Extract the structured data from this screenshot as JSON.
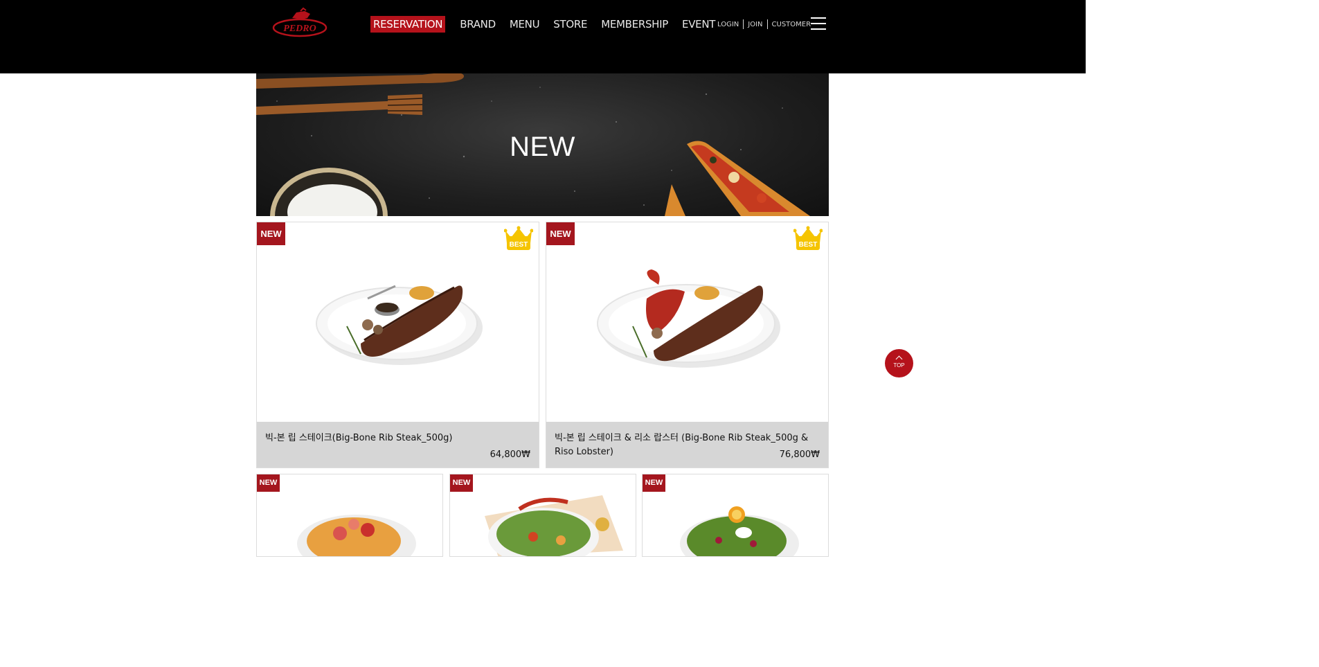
{
  "header": {
    "logo_text": "PEDRO",
    "nav": [
      "RESERVATION",
      "BRAND",
      "MENU",
      "STORE",
      "MEMBERSHIP",
      "EVENT"
    ],
    "util": [
      "LOGIN",
      "JOIN",
      "CUSTOMER"
    ],
    "menu_icon": "hamburger-icon"
  },
  "hero": {
    "title": "NEW"
  },
  "products_featured": [
    {
      "badge": "NEW",
      "best_label": "BEST",
      "name": "빅-본 립 스테이크(Big-Bone Rib Steak_500g)",
      "price": "64,800₩"
    },
    {
      "badge": "NEW",
      "best_label": "BEST",
      "name": "빅-본 립 스테이크 & 리소 랍스터 (Big-Bone Rib Steak_500g & Riso Lobster)",
      "price": "76,800₩"
    }
  ],
  "products_row2": [
    {
      "badge": "NEW"
    },
    {
      "badge": "NEW"
    },
    {
      "badge": "NEW"
    }
  ],
  "top_button": {
    "label": "TOP"
  },
  "colors": {
    "accent": "#b5121b",
    "header_bg": "#000000",
    "info_bg": "#d6d6d6",
    "best_gold": "#f5c400"
  }
}
